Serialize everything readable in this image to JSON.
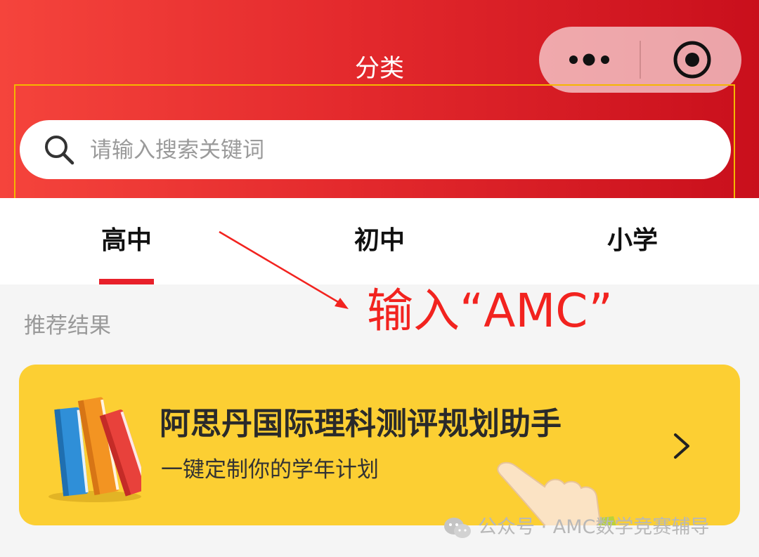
{
  "header": {
    "title": "分类",
    "capsule": {
      "more_icon": "more-dots-icon",
      "close_icon": "target-close-icon"
    }
  },
  "search": {
    "placeholder": "请输入搜索关键词",
    "value": "",
    "icon": "search-icon"
  },
  "tabs": [
    {
      "label": "高中",
      "active": true
    },
    {
      "label": "初中",
      "active": false
    },
    {
      "label": "小学",
      "active": false
    }
  ],
  "annotation": {
    "text": "输入“AMC”",
    "color": "#f2231f"
  },
  "section": {
    "label": "推荐结果"
  },
  "banner": {
    "title": "阿思丹国际理科测评规划助手",
    "subtitle": "一键定制你的学年计划",
    "icon": "books-icon",
    "arrow_icon": "chevron-right-icon",
    "background": "#fccf33"
  },
  "watermark": {
    "text": "公众号 · AMC数学竞赛辅导",
    "icon": "wechat-icon"
  },
  "colors": {
    "header_gradient_start": "#f5443c",
    "header_gradient_end": "#c90f1c",
    "tab_underline": "#e8202a",
    "highlight_border": "#f5b700"
  }
}
